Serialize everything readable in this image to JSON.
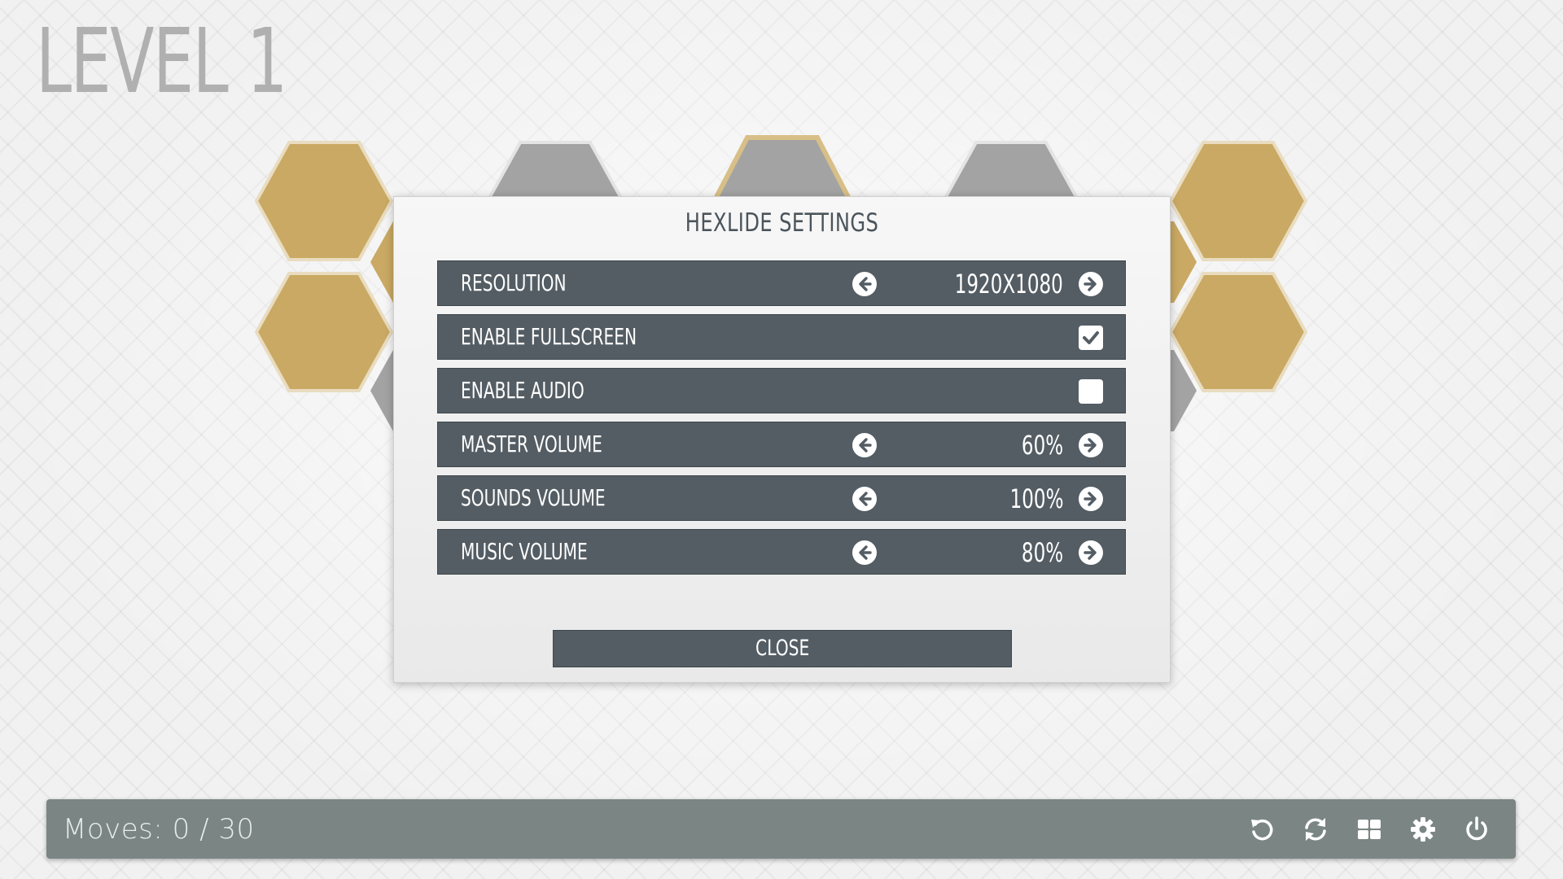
{
  "level": {
    "title": "LEVEL 1"
  },
  "dialog": {
    "title": "HEXLIDE SETTINGS",
    "rows": [
      {
        "label": "RESOLUTION",
        "value": "1920X1080",
        "type": "selector"
      },
      {
        "label": "ENABLE FULLSCREEN",
        "checked": true,
        "type": "checkbox"
      },
      {
        "label": "ENABLE AUDIO",
        "checked": false,
        "type": "checkbox"
      },
      {
        "label": "MASTER VOLUME",
        "value": "60%",
        "type": "selector"
      },
      {
        "label": "SOUNDS VOLUME",
        "value": "100%",
        "type": "selector"
      },
      {
        "label": "MUSIC VOLUME",
        "value": "80%",
        "type": "selector"
      }
    ],
    "close_label": "CLOSE"
  },
  "bottom_bar": {
    "moves_label": "Moves:",
    "moves_value": "0 / 30",
    "tools": [
      "undo-icon",
      "restart-icon",
      "level-select-icon",
      "settings-gear-icon",
      "power-icon"
    ]
  },
  "colors": {
    "gold_tile": "#c9a963",
    "grey_tile": "#a3a3a3",
    "row_bg": "#545d64",
    "bar_bg": "#7b8684"
  }
}
